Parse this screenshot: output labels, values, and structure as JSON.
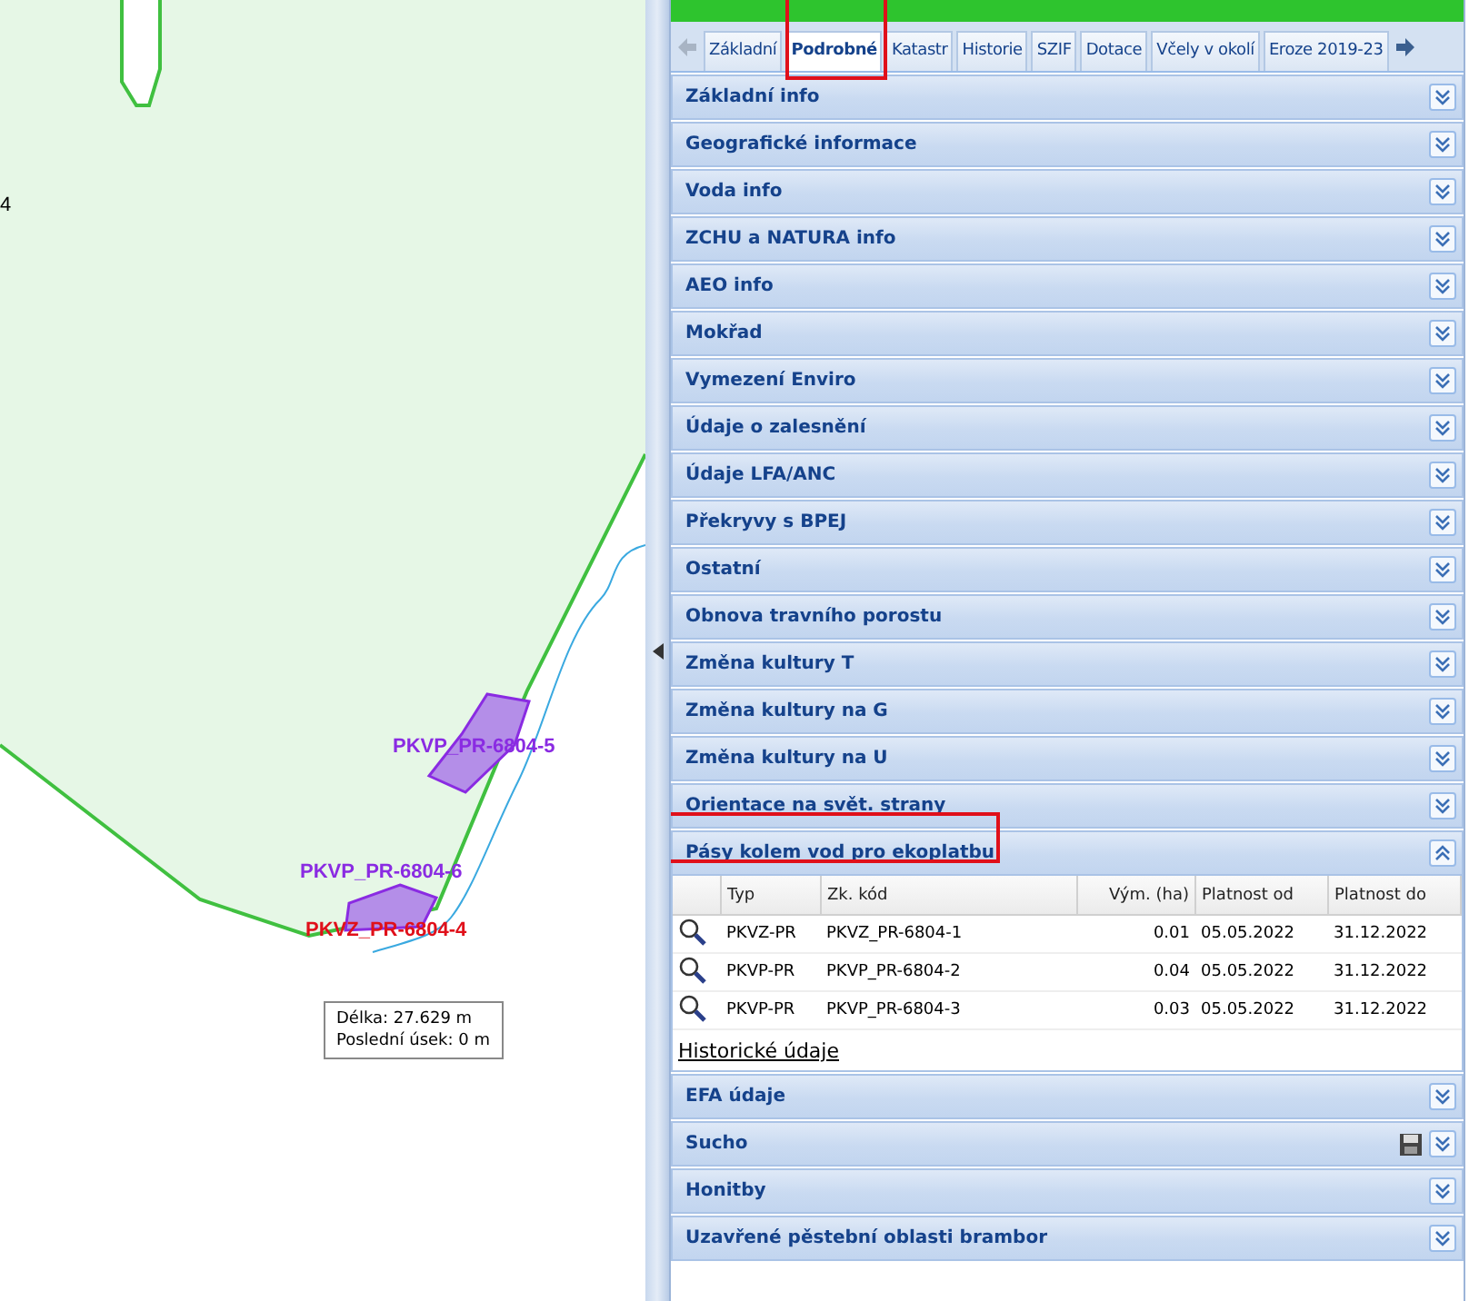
{
  "map": {
    "labels": [
      {
        "text": "PKVP_PR-6804-5",
        "color": "#8a2be2"
      },
      {
        "text": "PKVP_PR-6804-6",
        "color": "#8a2be2"
      },
      {
        "text": "PKVZ_PR-6804-4",
        "color": "#e0101a"
      }
    ],
    "edge_label": "4",
    "measure": {
      "length": "Délka: 27.629 m",
      "last": "Poslední úsek: 0 m"
    }
  },
  "tabs": [
    {
      "label": "Základní",
      "selected": false
    },
    {
      "label": "Podrobné",
      "selected": true
    },
    {
      "label": "Katastr",
      "selected": false
    },
    {
      "label": "Historie",
      "selected": false
    },
    {
      "label": "SZIF",
      "selected": false
    },
    {
      "label": "Dotace",
      "selected": false
    },
    {
      "label": "Včely v okolí",
      "selected": false
    },
    {
      "label": "Eroze 2019-23",
      "selected": false
    }
  ],
  "sections": [
    {
      "title": "Základní info",
      "expanded": false
    },
    {
      "title": "Geografické informace",
      "expanded": false
    },
    {
      "title": "Voda info",
      "expanded": false
    },
    {
      "title": "ZCHU a NATURA info",
      "expanded": false
    },
    {
      "title": "AEO info",
      "expanded": false
    },
    {
      "title": "Mokřad",
      "expanded": false
    },
    {
      "title": "Vymezení Enviro",
      "expanded": false
    },
    {
      "title": "Údaje o zalesnění",
      "expanded": false
    },
    {
      "title": "Údaje LFA/ANC",
      "expanded": false
    },
    {
      "title": "Překryvy s BPEJ",
      "expanded": false
    },
    {
      "title": "Ostatní",
      "expanded": false
    },
    {
      "title": "Obnova travního porostu",
      "expanded": false
    },
    {
      "title": "Změna kultury T",
      "expanded": false
    },
    {
      "title": "Změna kultury na G",
      "expanded": false
    },
    {
      "title": "Změna kultury na U",
      "expanded": false
    },
    {
      "title": "Orientace na svět. strany",
      "expanded": false
    },
    {
      "title": "Pásy kolem vod pro ekoplatbu",
      "expanded": true,
      "table": {
        "columns": [
          "Typ",
          "Zk. kód",
          "Vým. (ha)",
          "Platnost od",
          "Platnost do"
        ],
        "rows": [
          [
            "PKVZ-PR",
            "PKVZ_PR-6804-1",
            "0.01",
            "05.05.2022",
            "31.12.2022"
          ],
          [
            "PKVP-PR",
            "PKVP_PR-6804-2",
            "0.04",
            "05.05.2022",
            "31.12.2022"
          ],
          [
            "PKVP-PR",
            "PKVP_PR-6804-3",
            "0.03",
            "05.05.2022",
            "31.12.2022"
          ]
        ],
        "link": "Historické údaje"
      }
    },
    {
      "title": "EFA údaje",
      "expanded": false
    },
    {
      "title": "Sucho",
      "expanded": false,
      "save": true
    },
    {
      "title": "Honitby",
      "expanded": false
    },
    {
      "title": "Uzavřené pěstební oblasti brambor",
      "expanded": false
    }
  ]
}
